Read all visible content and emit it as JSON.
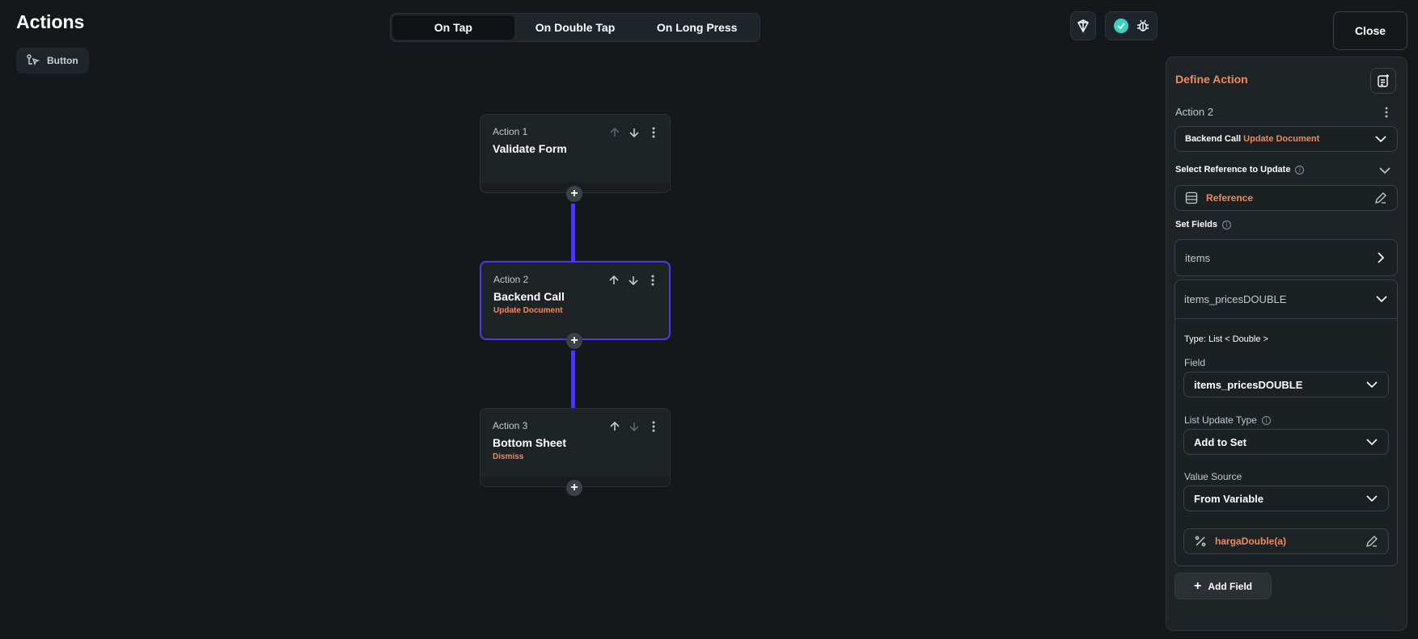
{
  "header": {
    "title": "Actions",
    "widget_label": "Button",
    "tabs": [
      {
        "label": "On Tap",
        "active": true
      },
      {
        "label": "On Double Tap",
        "active": false
      },
      {
        "label": "On Long Press",
        "active": false
      }
    ],
    "close_label": "Close"
  },
  "flow": {
    "actions": [
      {
        "label": "Action 1",
        "name": "Validate Form",
        "sub": ""
      },
      {
        "label": "Action 2",
        "name": "Backend Call",
        "sub": "Update Document"
      },
      {
        "label": "Action 3",
        "name": "Bottom Sheet",
        "sub": "Dismiss"
      }
    ],
    "accent_color": "#4b39ef"
  },
  "panel": {
    "title": "Define Action",
    "action_label": "Action 2",
    "action_type": "Backend Call",
    "action_subtype": "Update Document",
    "select_reference_label": "Select Reference to Update",
    "reference_value": "Reference",
    "set_fields_label": "Set Fields",
    "fields": [
      {
        "name": "items",
        "expanded": false
      },
      {
        "name": "items_pricesDOUBLE",
        "expanded": true
      }
    ],
    "expanded_field": {
      "type_text": "Type: List < Double >",
      "field_label": "Field",
      "field_value": "items_pricesDOUBLE",
      "list_update_type_label": "List Update Type",
      "list_update_type_value": "Add to Set",
      "value_source_label": "Value Source",
      "value_source_value": "From Variable",
      "variable_value": "hargaDouble(a)"
    },
    "add_field_label": "Add Field",
    "accent_color": "#ee8b60"
  }
}
